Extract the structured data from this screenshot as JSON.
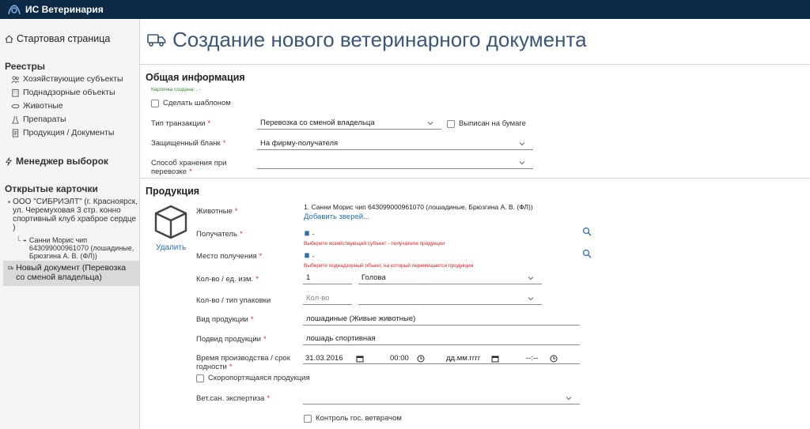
{
  "app": {
    "title": "ИС Ветеринария"
  },
  "sidebar": {
    "start_page": "Стартовая страница",
    "registries_title": "Реестры",
    "registries": [
      {
        "label": "Хозяйствующие субъекты",
        "icon": "people-icon"
      },
      {
        "label": "Поднадзорные объекты",
        "icon": "building-icon"
      },
      {
        "label": "Животные",
        "icon": "animal-icon"
      },
      {
        "label": "Препараты",
        "icon": "flask-icon"
      },
      {
        "label": "Продукция / Документы",
        "icon": "document-icon"
      }
    ],
    "selection_manager": "Менеджер выборок",
    "open_cards_title": "Открытые карточки",
    "open_cards": [
      "ООО \"СИБРИЭЛТ\" (г. Красноярск, ул. Черемуховая 3 стр. конно спортивный клуб храброе сердце )",
      "Санни Морис чип 643099000961070 (лошадиные, Брюзгина А. В. (ФЛ))",
      "Новый документ (Перевозка со сменой владельца)"
    ]
  },
  "page": {
    "title": "Создание нового ветеринарного документа"
  },
  "general": {
    "title": "Общая информация",
    "card_created": "Карточка создана: , -",
    "make_template": "Сделать шаблоном",
    "transaction_type_label": "Тип транзакции",
    "transaction_type_value": "Перевозка со сменой владельца",
    "paper_issued": "Выписан на бумаге",
    "protected_form_label": "Защищенный бланк",
    "protected_form_value": "На фирму-получателя",
    "storage_label": "Способ хранения при перевозке",
    "storage_value": ""
  },
  "product": {
    "title": "Продукция",
    "delete": "Удалить",
    "animals_label": "Животные",
    "animals_value": "1. Санни Морис чип 643099000961070 (лошадиные, Брюзгина А. В. (ФЛ))",
    "add_animals": "Добавить зверей...",
    "recipient_label": "Получатель",
    "recipient_value": "-",
    "recipient_error": "Выберите хозяйствующий субъект - получателя продукции",
    "place_label": "Место получения",
    "place_value": "-",
    "place_error": "Выберите поднадзорный объект, на который перемещается продукция",
    "qty_label": "Кол-во / ед. изм.",
    "qty_value": "1",
    "unit_value": "Голова",
    "pack_label": "Кол-во / тип упаковки",
    "pack_placeholder": "Кол-во",
    "pack_type_value": "",
    "kind_label": "Вид продукции",
    "kind_value": "лошадиные (Живые животные)",
    "subkind_label": "Подвид продукции",
    "subkind_value": "лошадь спортивная",
    "prod_time_label": "Время производства / срок годности",
    "prod_date": "31.03.2016",
    "prod_time": "00:00",
    "exp_date": "дд.мм.гггг",
    "exp_time": "--:--",
    "perishable": "Скоропортящаяся продукция",
    "vet_exam_label": "Вет.сан. экспертиза",
    "vet_exam_value": "",
    "state_control": "Контроль гос. ветврачом"
  },
  "colors": {
    "topbar": "#0e2a47",
    "title": "#39577a",
    "link": "#1e6fb8",
    "error": "#e01b1b",
    "required": "#d32f2f"
  }
}
